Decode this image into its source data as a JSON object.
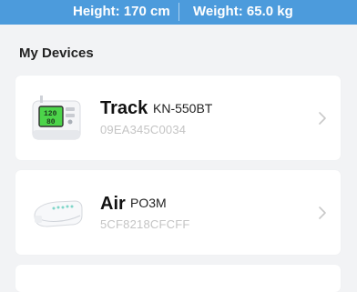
{
  "header": {
    "height_text": "Height: 170 cm",
    "weight_text": "Weight: 65.0 kg"
  },
  "section_title": "My Devices",
  "devices": [
    {
      "name": "Track",
      "model": "KN-550BT",
      "id": "09EA345C0034",
      "image": "blood-pressure-monitor-image",
      "screen_values": [
        "120",
        "80"
      ]
    },
    {
      "name": "Air",
      "model": "PO3M",
      "id": "5CF8218CFCFF",
      "image": "pulse-oximeter-image"
    }
  ],
  "colors": {
    "header_bg": "#4c9bdc",
    "page_bg": "#f2f3f5",
    "card_bg": "#ffffff",
    "id_text": "#c4c4c4",
    "chevron": "#c8c8c8",
    "monitor_screen": "#4cd44a"
  },
  "icons": {
    "chevron": "chevron-right-icon"
  }
}
